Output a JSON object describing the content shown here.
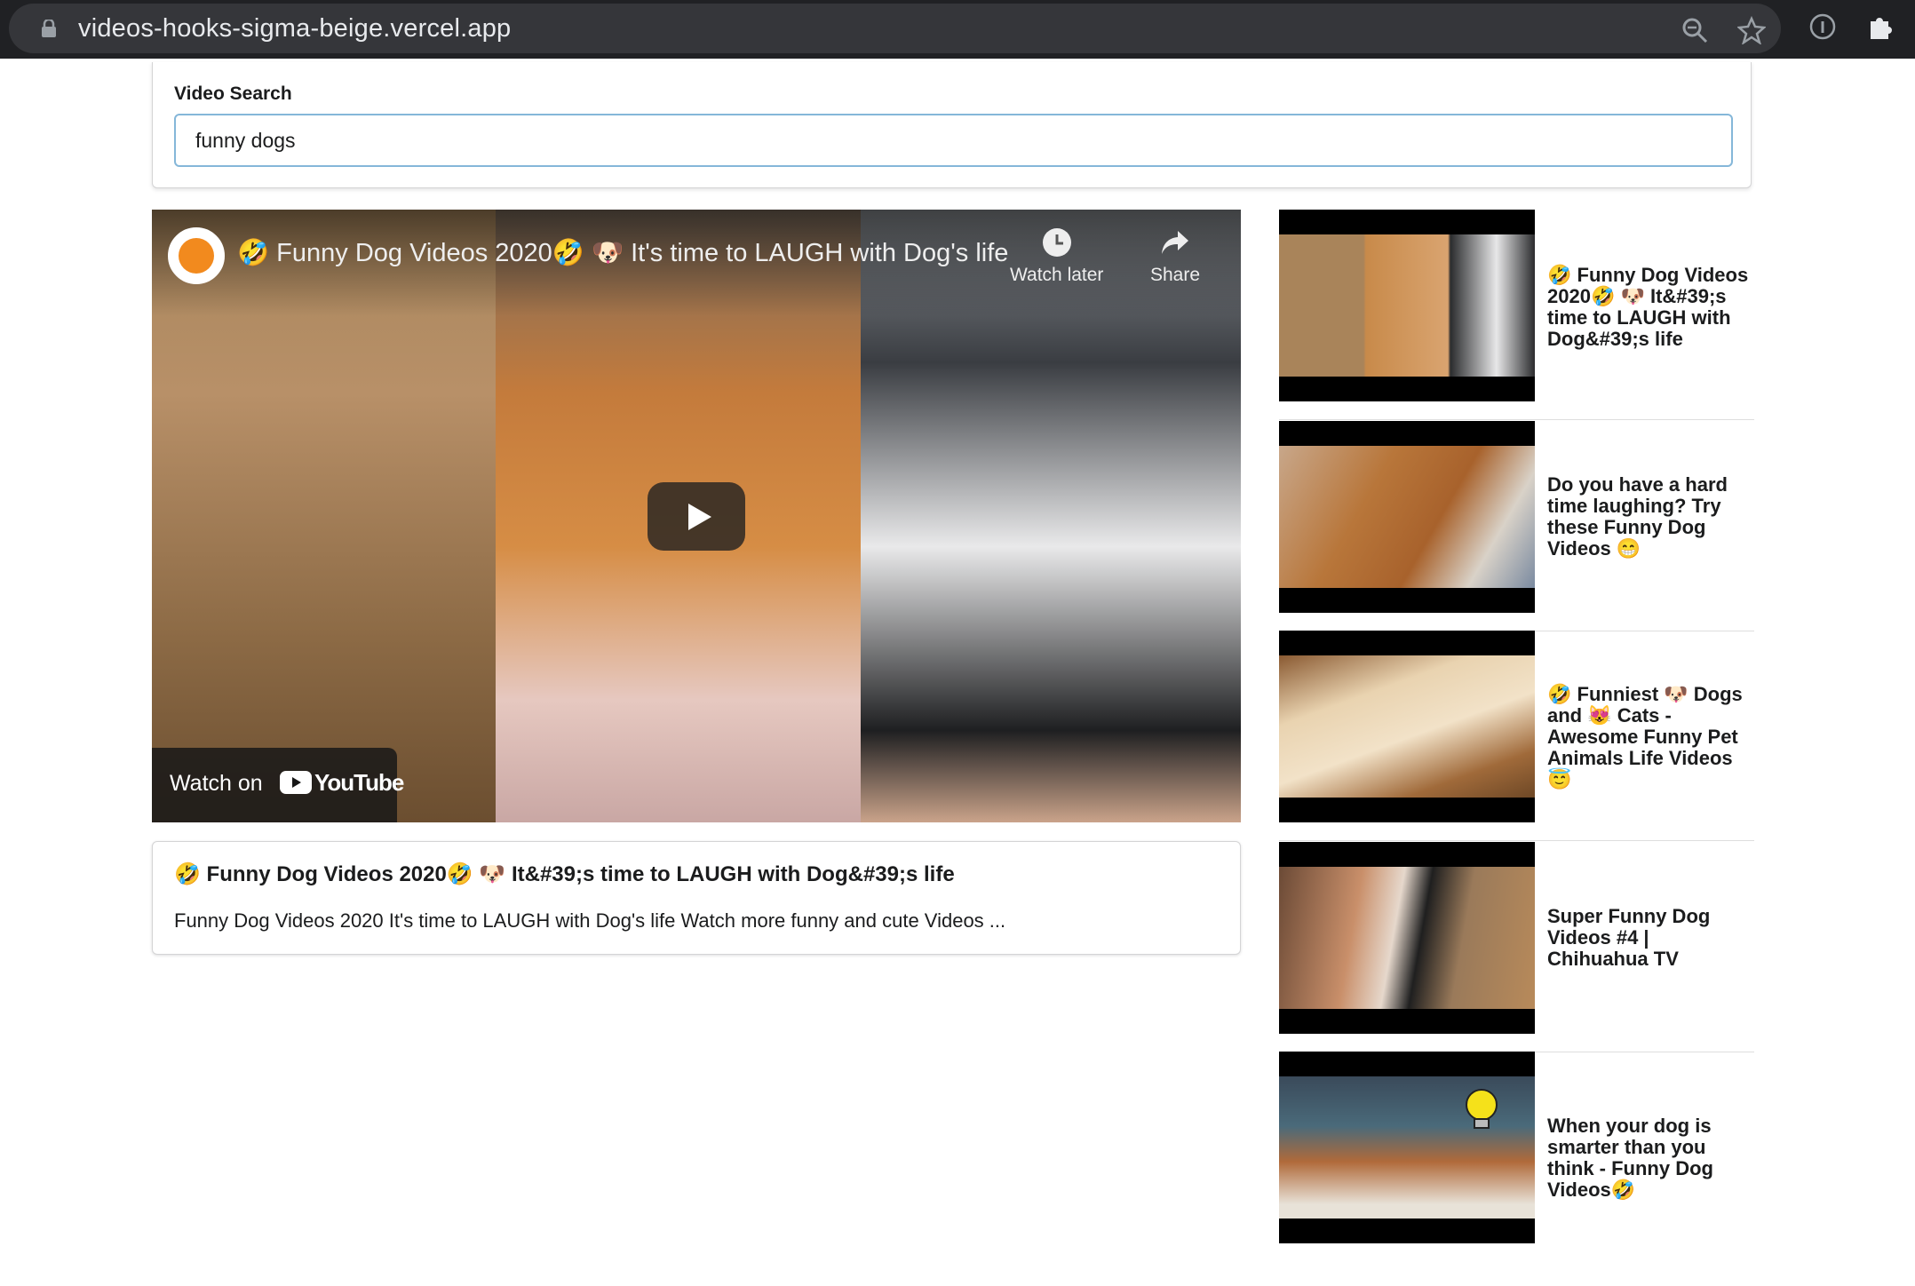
{
  "browser": {
    "url": "videos-hooks-sigma-beige.vercel.app"
  },
  "search": {
    "label": "Video Search",
    "value": "funny dogs"
  },
  "player": {
    "title": "🤣 Funny Dog Videos 2020🤣 🐶 It's time to LAUGH with Dog's life",
    "watch_later_label": "Watch later",
    "share_label": "Share",
    "watch_on_label": "Watch on",
    "youtube_label": "YouTube"
  },
  "detail": {
    "title": "🤣 Funny Dog Videos 2020🤣 🐶 It&#39;s time to LAUGH with Dog&#39;s life",
    "description": "Funny Dog Videos 2020 It's time to LAUGH with Dog's life Watch more funny and cute Videos ..."
  },
  "videos": [
    {
      "title": "🤣 Funny Dog Videos 2020🤣 🐶 It&#39;s time to LAUGH with Dog&#39;s life"
    },
    {
      "title": "Do you have a hard time laughing? Try these Funny Dog Videos 😁"
    },
    {
      "title": "🤣 Funniest 🐶 Dogs and 😻 Cats - Awesome Funny Pet Animals Life Videos 😇"
    },
    {
      "title": "Super Funny Dog Videos #4 | Chihuahua TV"
    },
    {
      "title": "When your dog is smarter than you think - Funny Dog Videos🤣"
    }
  ],
  "colors": {
    "chrome_bg": "#202124",
    "urlbar_bg": "#35363a",
    "input_focus_border": "#85b7d9"
  }
}
